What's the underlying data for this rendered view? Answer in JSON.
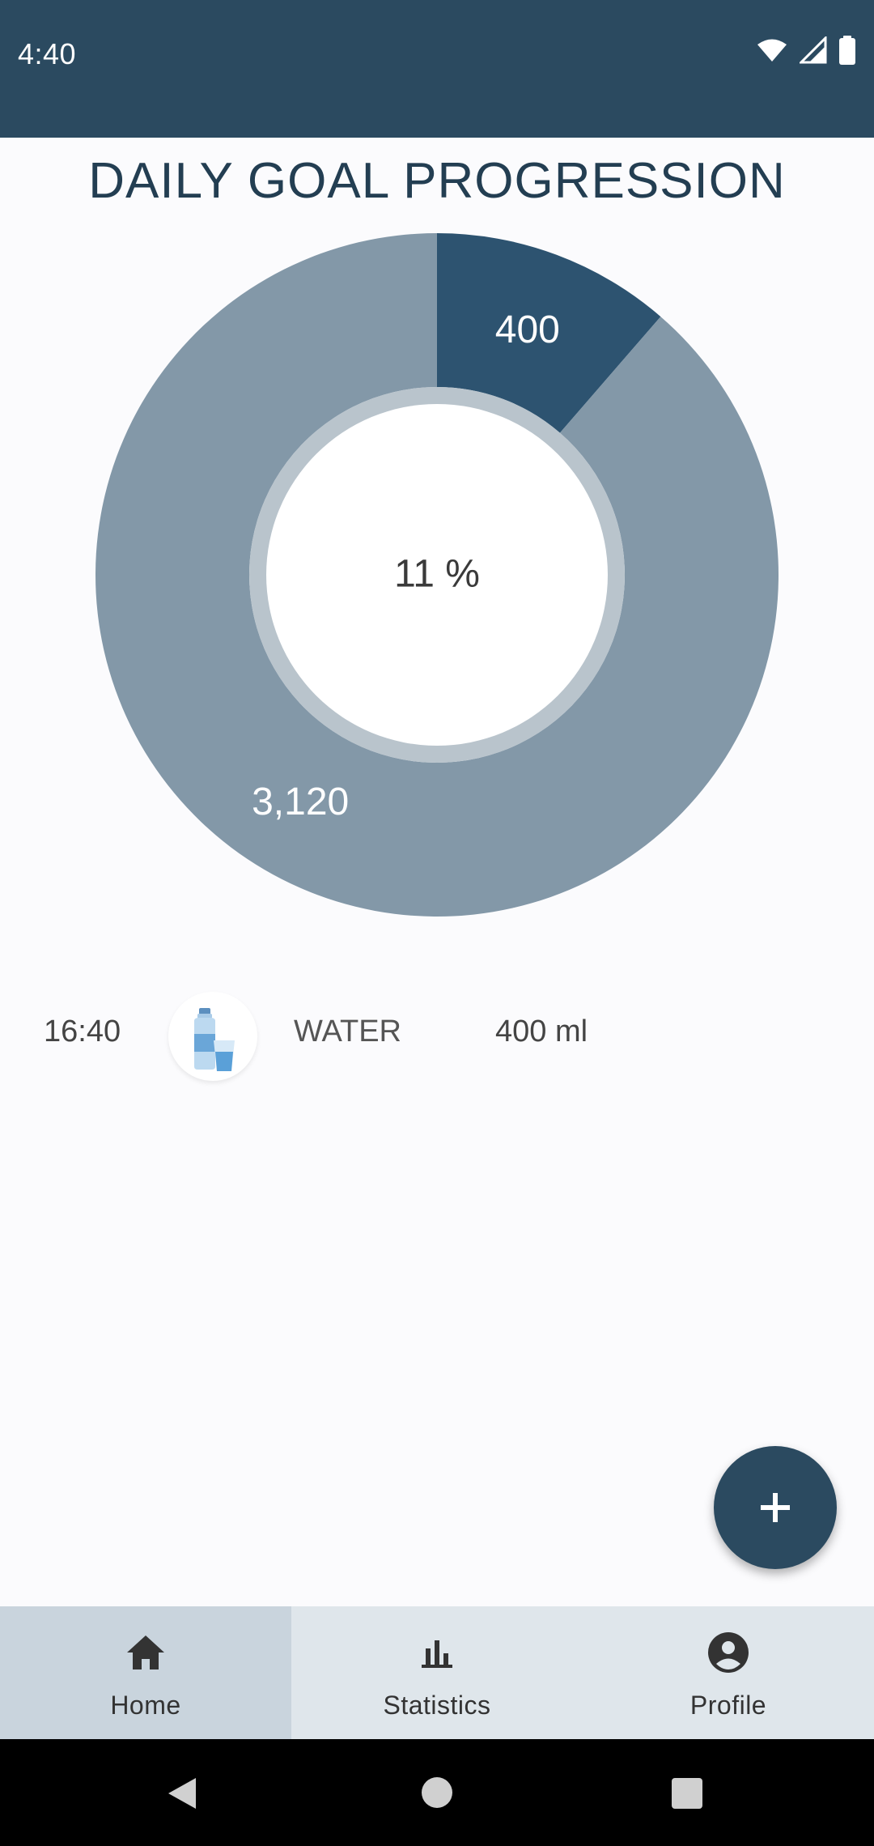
{
  "status_bar": {
    "time": "4:40",
    "icons": [
      "wifi-icon",
      "signal-icon",
      "battery-icon"
    ]
  },
  "page": {
    "title": "DAILY GOAL PROGRESSION"
  },
  "chart_data": {
    "type": "pie",
    "categories": [
      "consumed",
      "remaining"
    ],
    "values": [
      400,
      3120
    ],
    "slice_labels": [
      "400",
      "3,120"
    ],
    "center_label": "11 %",
    "colors": [
      "#2d5370",
      "#8398a8"
    ]
  },
  "log": {
    "items": [
      {
        "time": "16:40",
        "icon": "water-bottle-glass-icon",
        "type": "WATER",
        "amount": "400 ml"
      }
    ]
  },
  "fab": {
    "icon": "plus-icon"
  },
  "bottom_nav": {
    "items": [
      {
        "label": "Home",
        "icon": "home-icon",
        "active": true
      },
      {
        "label": "Statistics",
        "icon": "bar-chart-icon",
        "active": false
      },
      {
        "label": "Profile",
        "icon": "account-circle-icon",
        "active": false
      }
    ]
  },
  "system_nav": {
    "icons": [
      "back-icon",
      "home-circle-icon",
      "recents-icon"
    ]
  },
  "colors": {
    "primary": "#2b4a60",
    "accent_slice": "#2d5370",
    "remaining_slice": "#8398a8",
    "background": "#fbfbfd"
  }
}
